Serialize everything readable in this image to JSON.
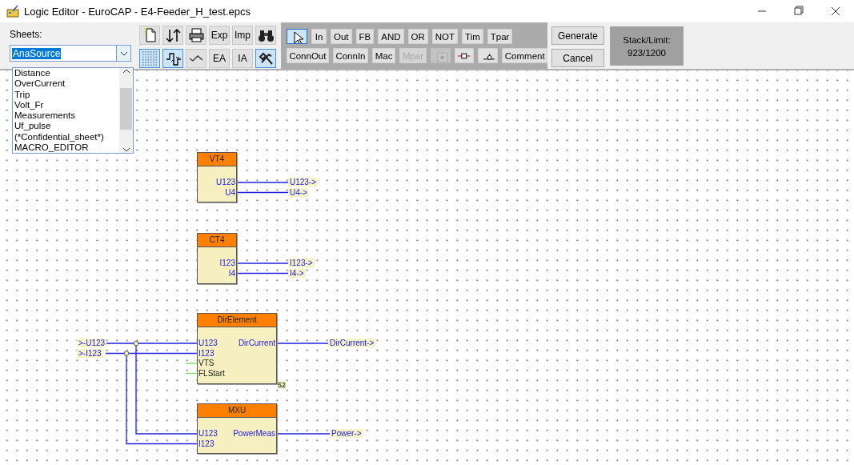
{
  "window": {
    "title": "Logic Editor - EuroCAP - E4-Feeder_H_test.epcs"
  },
  "sheets": {
    "label": "Sheets:",
    "value": "AnaSource",
    "expanded": true,
    "items": [
      {
        "label": "Distance",
        "selected": false
      },
      {
        "label": "OverCurrent",
        "selected": false
      },
      {
        "label": "Trip",
        "selected": false
      },
      {
        "label": "Volt_Fr",
        "selected": false
      },
      {
        "label": "Measurements",
        "selected": false
      },
      {
        "label": "Uf_pulse",
        "selected": false
      },
      {
        "label": "(*Confidential_sheet*)",
        "selected": false
      },
      {
        "label": "MACRO_EDITOR",
        "selected": false
      }
    ]
  },
  "file_tools": [
    [
      {
        "kind": "icon",
        "pressed": false
      },
      {
        "kind": "icon",
        "pressed": false
      },
      {
        "kind": "icon",
        "pressed": false
      },
      {
        "kind": "text",
        "label": "Exp",
        "pressed": false
      },
      {
        "kind": "text",
        "label": "Imp",
        "pressed": false
      },
      {
        "kind": "icon",
        "pressed": false
      }
    ],
    [
      {
        "kind": "icon",
        "pressed": true
      },
      {
        "kind": "icon",
        "pressed": true
      },
      {
        "kind": "icon",
        "pressed": false
      },
      {
        "kind": "text",
        "label": "EA",
        "pressed": false
      },
      {
        "kind": "text",
        "label": "IA",
        "pressed": false
      },
      {
        "kind": "icon",
        "pressed": true
      }
    ]
  ],
  "palette": [
    [
      {
        "kind": "icon",
        "selected": true,
        "disabled": false
      },
      {
        "kind": "text",
        "label": "In",
        "selected": false,
        "disabled": false
      },
      {
        "kind": "text",
        "label": "Out",
        "selected": false,
        "disabled": false
      },
      {
        "kind": "text",
        "label": "FB",
        "selected": false,
        "disabled": false
      },
      {
        "kind": "text",
        "label": "AND",
        "selected": false,
        "disabled": false
      },
      {
        "kind": "text",
        "label": "OR",
        "selected": false,
        "disabled": false
      },
      {
        "kind": "text",
        "label": "NOT",
        "selected": false,
        "disabled": false
      },
      {
        "kind": "text",
        "label": "Tim",
        "selected": false,
        "disabled": false
      },
      {
        "kind": "text",
        "label": "Tpar",
        "selected": false,
        "disabled": false
      }
    ],
    [
      {
        "kind": "text",
        "label": "ConnOut",
        "selected": false,
        "disabled": false
      },
      {
        "kind": "text",
        "label": "ConnIn",
        "selected": false,
        "disabled": false
      },
      {
        "kind": "text",
        "label": "Mac",
        "selected": false,
        "disabled": false
      },
      {
        "kind": "text",
        "label": "Mpar",
        "selected": false,
        "disabled": true
      },
      {
        "kind": "icon",
        "selected": false,
        "disabled": true
      },
      {
        "kind": "icon",
        "selected": false,
        "disabled": false
      },
      {
        "kind": "icon",
        "selected": false,
        "disabled": false
      },
      {
        "kind": "text",
        "label": "Comment",
        "selected": false,
        "disabled": false
      }
    ]
  ],
  "actions": [
    "Generate",
    "Cancel"
  ],
  "stack": {
    "label": "Stack/Limit:",
    "value": "923/1200"
  },
  "diagram": {
    "input_connectors": [
      ">-U123",
      ">-I123"
    ],
    "blocks": [
      {
        "title": "VT4",
        "outputs": [
          {
            "pin": "U123",
            "label": "U123->"
          },
          {
            "pin": "U4",
            "label": "U4->"
          }
        ]
      },
      {
        "title": "CT4",
        "outputs": [
          {
            "pin": "I123",
            "label": "I123->"
          },
          {
            "pin": "I4",
            "label": "I4->"
          }
        ]
      },
      {
        "title": "DirElement",
        "number": "52",
        "inputs": [
          {
            "pin": "U123",
            "connected": true
          },
          {
            "pin": "I123",
            "connected": true
          },
          {
            "pin": "VTS",
            "connected": false
          },
          {
            "pin": "FLStart",
            "connected": false
          }
        ],
        "outputs": [
          {
            "pin": "DirCurrent",
            "label": "DirCurrent->"
          }
        ]
      },
      {
        "title": "MXU",
        "inputs": [
          {
            "pin": "U123",
            "connected": true
          },
          {
            "pin": "I123",
            "connected": true
          }
        ],
        "outputs": [
          {
            "pin": "PowerMeas",
            "label": "Power->"
          }
        ]
      }
    ]
  }
}
